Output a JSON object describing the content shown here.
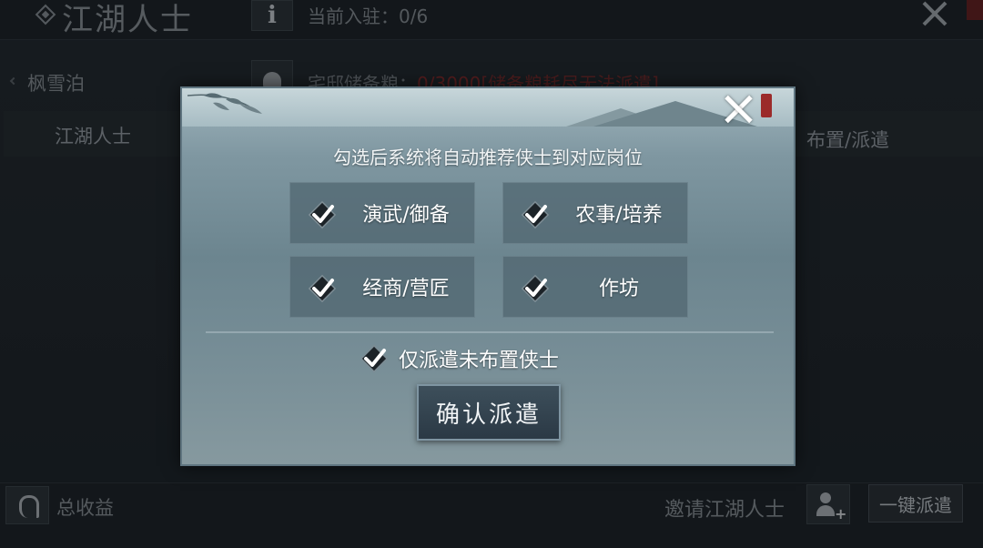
{
  "header": {
    "title": "江湖人士",
    "info_icon": "i",
    "stationed_text": "当前入驻：0/6"
  },
  "region": {
    "name": "枫雪泊"
  },
  "grain": {
    "prefix": "宅邸储备粮：",
    "value": "0/3000",
    "note": "[储备粮耗尽无法派遣]"
  },
  "table": {
    "col_left": "江湖人士",
    "col_right": "布置/派遣"
  },
  "bottom": {
    "income_label": "总收益",
    "invite_label": "邀请江湖人士",
    "dispatch_all_label": "一键派遣"
  },
  "dialog": {
    "hint": "勾选后系统将自动推荐侠士到对应岗位",
    "options": [
      {
        "label": "演武/御备",
        "checked": true
      },
      {
        "label": "农事/培养",
        "checked": true
      },
      {
        "label": "经商/营匠",
        "checked": true
      },
      {
        "label": "作坊",
        "checked": true
      }
    ],
    "only_unassigned": {
      "label": "仅派遣未布置侠士",
      "checked": true
    },
    "confirm_label": "确认派遣"
  },
  "colors": {
    "dialog_bg": "#7f97a1",
    "confirm_bg": "#2b3945",
    "grain_warning": "#8b2a2a"
  },
  "icons": [
    "info-icon",
    "bag-icon",
    "close-icon",
    "check-icon",
    "income-icon",
    "add-user-icon"
  ]
}
